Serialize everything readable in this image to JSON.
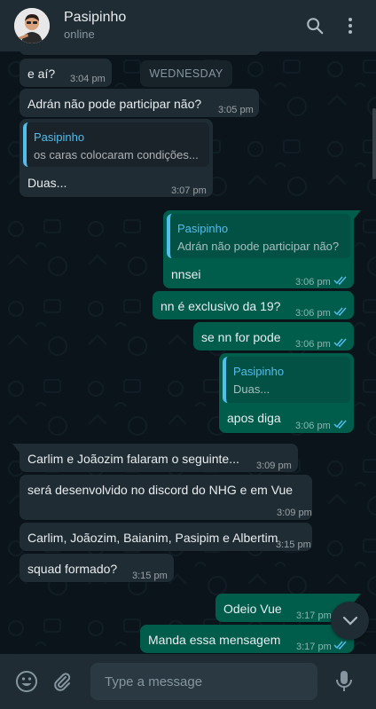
{
  "header": {
    "name": "Pasipinho",
    "status": "online"
  },
  "day_divider": "WEDNESDAY",
  "messages": [
    {
      "text": "e aí?",
      "time": "3:04 pm"
    },
    {
      "text": "Adrán não pode participar não?",
      "time": "3:05 pm"
    },
    {
      "quote_author": "Pasipinho",
      "quote_text": "os caras colocaram condições...",
      "text": "Duas...",
      "time": "3:07 pm"
    },
    {
      "quote_author": "Pasipinho",
      "quote_text": "Adrán não pode participar não?",
      "text": "nnsei",
      "time": "3:06 pm"
    },
    {
      "text": "nn é exclusivo da 19?",
      "time": "3:06 pm"
    },
    {
      "text": "se nn for pode",
      "time": "3:06 pm"
    },
    {
      "quote_author": "Pasipinho",
      "quote_text": "Duas...",
      "text": "apos diga",
      "time": "3:06 pm"
    },
    {
      "text": "Carlim e Joãozim falaram o seguinte...",
      "time": "3:09 pm"
    },
    {
      "text": "será desenvolvido no discord do NHG e em Vue",
      "time": "3:09 pm"
    },
    {
      "text": "Carlim, Joãozim, Baianim, Pasipim e Albertim",
      "time": "3:15 pm"
    },
    {
      "text": "squad formado?",
      "time": "3:15 pm"
    },
    {
      "text": "Odeio Vue",
      "time": "3:17 pm"
    },
    {
      "text": "Manda essa mensagem",
      "time": "3:17 pm"
    }
  ],
  "composer": {
    "placeholder": "Type a message"
  },
  "colors": {
    "header": "#1f2c34",
    "incoming": "#1f2c34",
    "outgoing": "#005c4b",
    "read_ticks": "#53bdeb",
    "quote_accent": "#53bdeb"
  }
}
